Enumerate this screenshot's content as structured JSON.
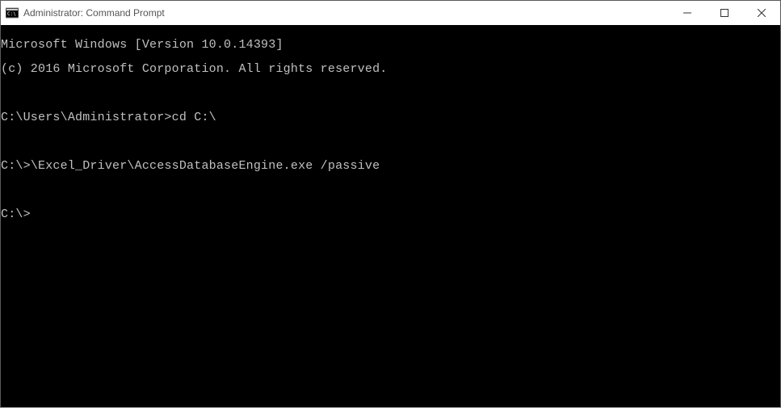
{
  "window": {
    "title": "Administrator: Command Prompt"
  },
  "terminal": {
    "line1": "Microsoft Windows [Version 10.0.14393]",
    "line2": "(c) 2016 Microsoft Corporation. All rights reserved.",
    "blank1": "",
    "prompt1_path": "C:\\Users\\Administrator>",
    "prompt1_cmd": "cd C:\\",
    "blank2": "",
    "prompt2_path": "C:\\>",
    "prompt2_cmd": "\\Excel_Driver\\AccessDatabaseEngine.exe /passive",
    "blank3": "",
    "prompt3_path": "C:\\>",
    "prompt3_cmd": ""
  }
}
